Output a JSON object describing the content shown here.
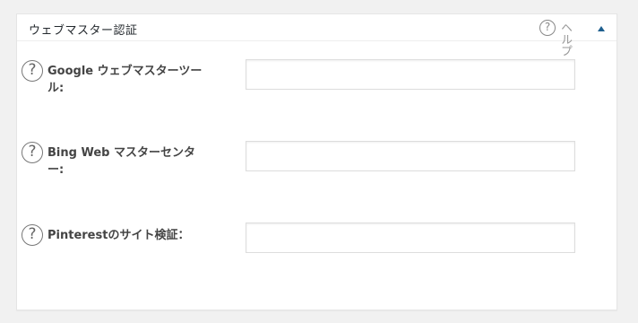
{
  "panel": {
    "title": "ウェブマスター認証",
    "help_label": "ヘルプ",
    "help_symbol": "?"
  },
  "fields": [
    {
      "label": "Google ウェブマスターツール:",
      "value": "",
      "placeholder": "",
      "help_symbol": "?"
    },
    {
      "label": "Bing Web マスターセンター:",
      "value": "",
      "placeholder": "",
      "help_symbol": "?"
    },
    {
      "label": "Pinterestのサイト検証：",
      "value": "",
      "placeholder": "",
      "help_symbol": "?"
    }
  ],
  "colors": {
    "background": "#f1f1f1",
    "panel": "#ffffff",
    "toggle_arrow": "#1e5f8e"
  },
  "icons": {
    "help": "question-circle-icon",
    "toggle": "triangle-up-icon"
  }
}
